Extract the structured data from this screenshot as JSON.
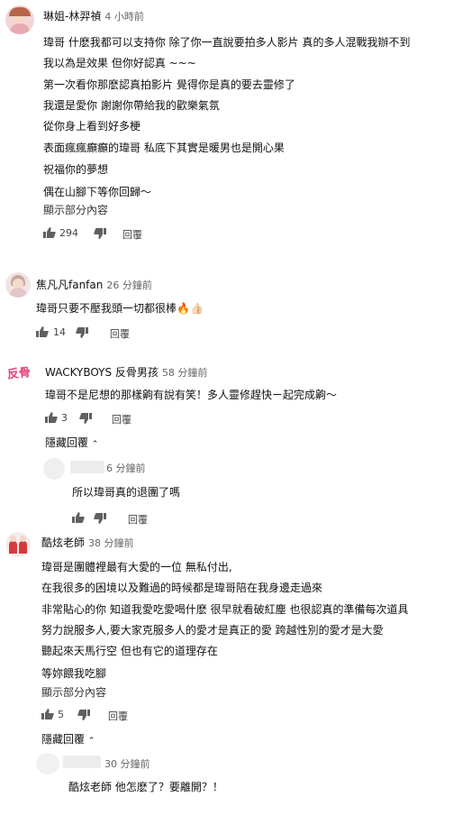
{
  "comments": [
    {
      "author": "琳姐-林羿禎",
      "time": "4 小時前",
      "lines": [
        "瑋哥 什麽我都可以支持你 除了你一直說要拍多人影片 真的多人混戰我辦不到",
        "我以為是效果 但你好認真 ~~~",
        "第一次看你那麽認真拍影片 覺得你是真的要去靈修了",
        "我還是愛你 謝謝你帶給我的歡樂氣氛",
        "從你身上看到好多梗",
        "表面瘋瘋癲癲的瑋哥 私底下其實是暖男也是開心果",
        "祝福你的夢想",
        "偶在山腳下等你回歸〜"
      ],
      "show_more": "顯示部分內容",
      "likes": "294",
      "reply": "回覆"
    },
    {
      "author": "焦凡凡fanfan",
      "time": "26 分鐘前",
      "lines": [
        "瑋哥只要不壓我頭一切都很棒🔥👍🏻"
      ],
      "likes": "14",
      "reply": "回覆"
    },
    {
      "author": "WACKYBOYS 反骨男孩",
      "time": "58 分鐘前",
      "lines": [
        "瑋哥不是尼想的那樣齁有說有笑！多人靈修趕快ㄧ起完成齁〜"
      ],
      "likes": "3",
      "reply": "回覆",
      "hide_replies": "隱藏回覆",
      "reply_item": {
        "time": "6 分鐘前",
        "text": "所以瑋哥真的退團了嗎",
        "reply": "回覆"
      }
    },
    {
      "author": "酷炫老師",
      "time": "38 分鐘前",
      "lines": [
        "瑋哥是團體裡最有大愛的一位 無私付出,",
        "在我很多的困境以及難過的時候都是瑋哥陪在我身邊走過來",
        "非常貼心的你 知道我愛吃愛喝什麽 很早就看破紅塵 也很認真的準備每次道具",
        "努力說服多人,要大家克服多人的愛才是真正的愛 跨越性別的愛才是大愛",
        "聽起來天馬行空 但也有它的道理存在",
        "等妳餵我吃腳"
      ],
      "show_more": "顯示部分內容",
      "likes": "5",
      "reply": "回覆",
      "hide_replies": "隱藏回覆",
      "reply_item": {
        "time": "30 分鐘前",
        "text": "酷炫老師 他怎麽了？要離開？！"
      }
    }
  ],
  "logo_text": "反骨",
  "colors": {
    "text": "#111111",
    "meta": "#666666",
    "icon": "#606060",
    "accent": "#e8407a"
  }
}
